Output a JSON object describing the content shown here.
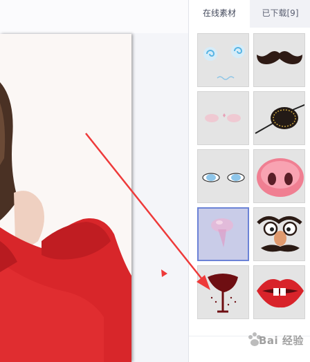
{
  "tabs": [
    {
      "label": "在线素材",
      "active": true
    },
    {
      "label": "已下载[9]",
      "active": false
    }
  ],
  "stickers": [
    {
      "name": "dizzy-eyes-icon"
    },
    {
      "name": "mustache-icon"
    },
    {
      "name": "blush-icon"
    },
    {
      "name": "eye-patch-icon"
    },
    {
      "name": "cartoon-eyes-icon"
    },
    {
      "name": "pig-nose-icon"
    },
    {
      "name": "tongue-icon",
      "selected": true
    },
    {
      "name": "funny-glasses-icon"
    },
    {
      "name": "dripping-lips-icon"
    },
    {
      "name": "vampire-lips-icon"
    }
  ],
  "watermark": {
    "text": "Bai 经验"
  },
  "colors": {
    "arrow": "#ee3a3a",
    "selection_border": "#6b82d6",
    "photo_red": "#d8262a"
  }
}
